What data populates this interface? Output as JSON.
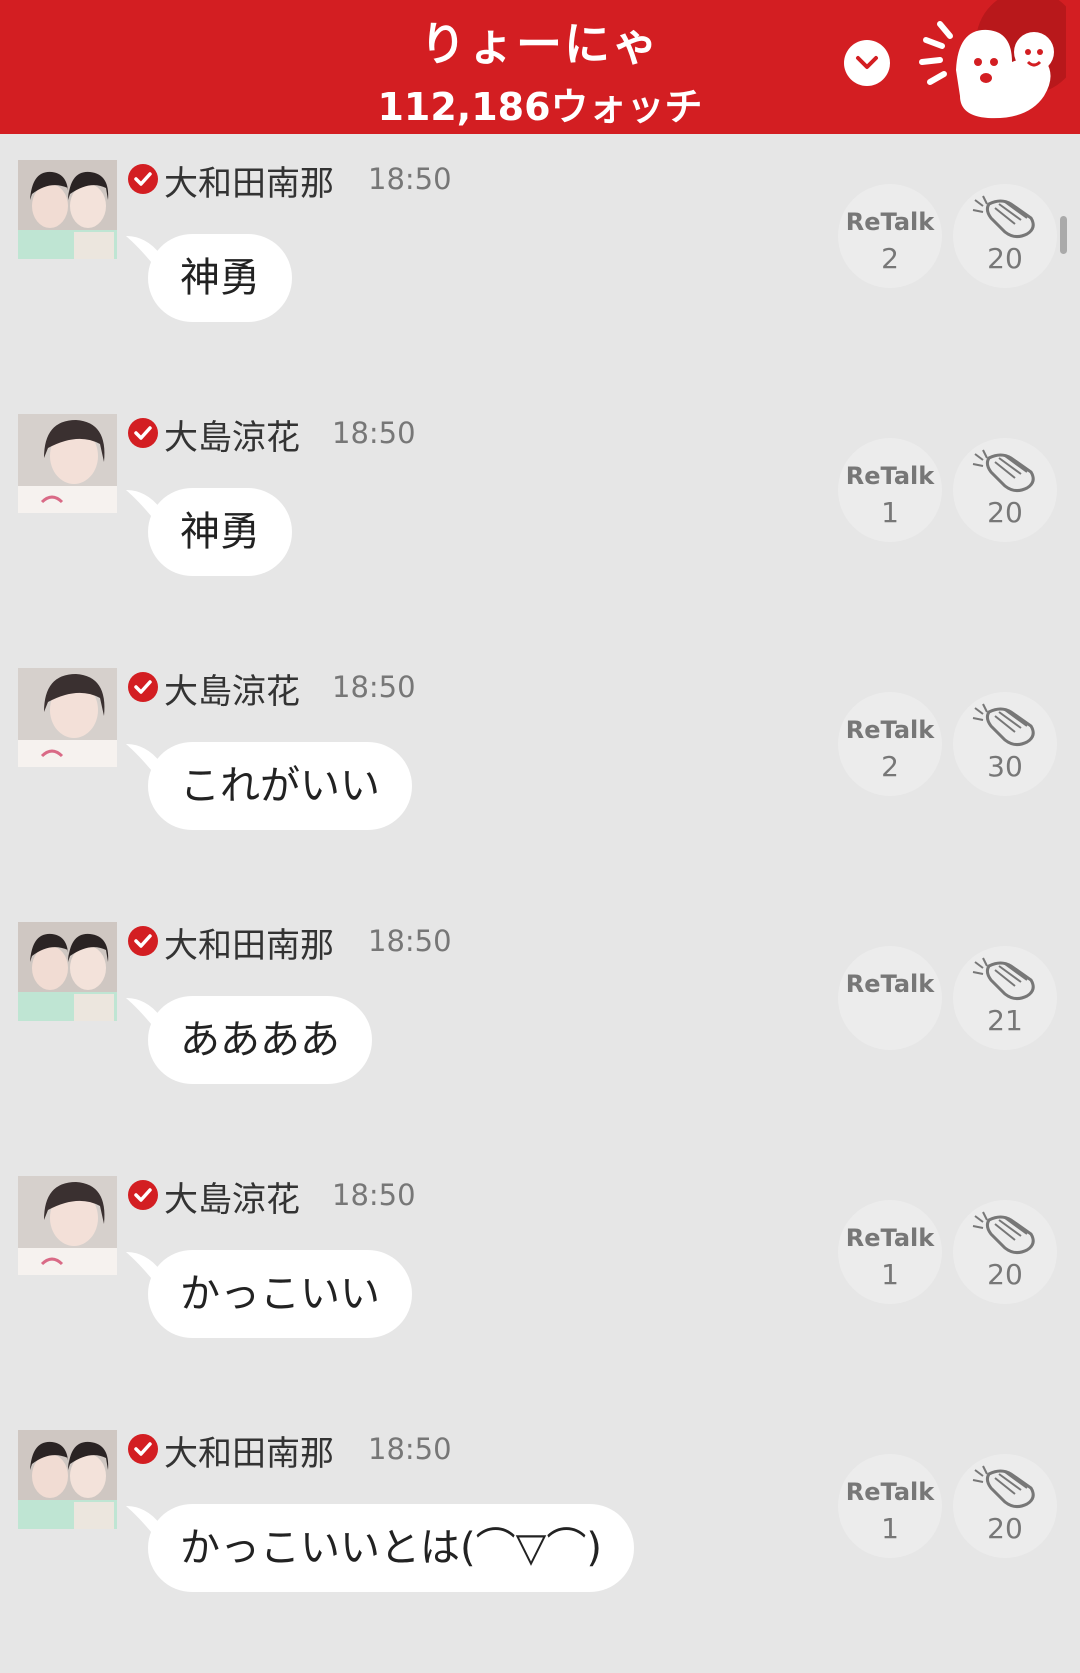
{
  "header": {
    "title": "りょーにゃ",
    "watch_count": "112,186ウォッチ",
    "dropdown_icon": "chevron-down-icon",
    "mascot_icon": "ghost-mascot-icon",
    "color": "#d31e22"
  },
  "messages": [
    {
      "name": "大和田南那",
      "time": "18:50",
      "text": "神勇",
      "retalk_label": "ReTalk",
      "retalk_count": "2",
      "clap_count": "20",
      "avatar": "two-girls-photo"
    },
    {
      "name": "大島涼花",
      "time": "18:50",
      "text": "神勇",
      "retalk_label": "ReTalk",
      "retalk_count": "1",
      "clap_count": "20",
      "avatar": "girl-selfie-photo"
    },
    {
      "name": "大島涼花",
      "time": "18:50",
      "text": "これがいい",
      "retalk_label": "ReTalk",
      "retalk_count": "2",
      "clap_count": "30",
      "avatar": "girl-selfie-photo"
    },
    {
      "name": "大和田南那",
      "time": "18:50",
      "text": "ああああ",
      "retalk_label": "ReTalk",
      "retalk_count": "",
      "clap_count": "21",
      "avatar": "two-girls-photo"
    },
    {
      "name": "大島涼花",
      "time": "18:50",
      "text": "かっこいい",
      "retalk_label": "ReTalk",
      "retalk_count": "1",
      "clap_count": "20",
      "avatar": "girl-selfie-photo"
    },
    {
      "name": "大和田南那",
      "time": "18:50",
      "text": "かっこいいとは(⌒▽⌒)",
      "retalk_label": "ReTalk",
      "retalk_count": "1",
      "clap_count": "20",
      "avatar": "two-girls-photo"
    }
  ]
}
